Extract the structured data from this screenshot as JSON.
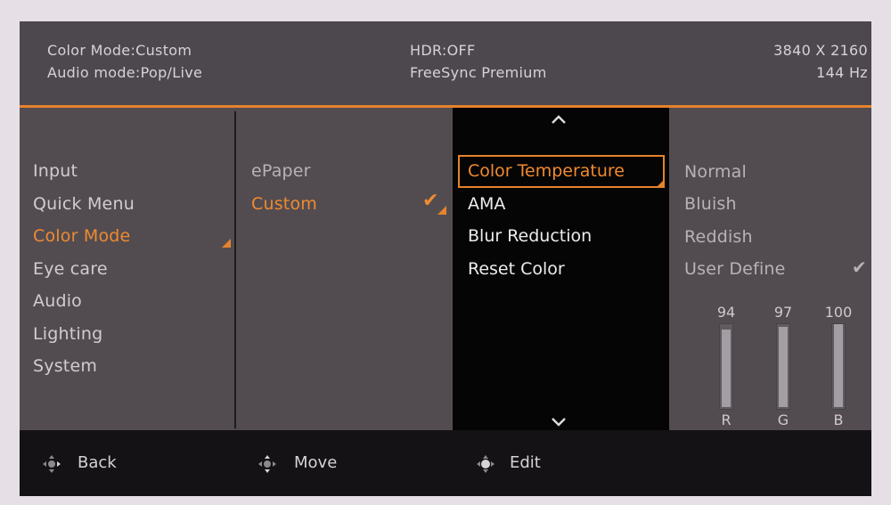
{
  "header": {
    "color_mode": "Color Mode:Custom",
    "audio_mode": "Audio mode:Pop/Live",
    "hdr": "HDR:OFF",
    "freesync": "FreeSync Premium",
    "resolution": "3840 X 2160",
    "refresh": "144 Hz"
  },
  "main_menu": {
    "items": [
      "Input",
      "Quick Menu",
      "Color Mode",
      "Eye care",
      "Audio",
      "Lighting",
      "System"
    ],
    "active": "Color Mode"
  },
  "color_modes": {
    "items": [
      "ePaper",
      "Custom"
    ],
    "active": "Custom"
  },
  "custom_options": {
    "items": [
      "Color Temperature",
      "AMA",
      "Blur Reduction",
      "Reset Color"
    ],
    "active": "Color Temperature"
  },
  "color_temperature": {
    "items": [
      "Normal",
      "Bluish",
      "Reddish",
      "User Define"
    ],
    "checked": "User Define",
    "rgb": [
      {
        "letter": "R",
        "value": 94
      },
      {
        "letter": "G",
        "value": 97
      },
      {
        "letter": "B",
        "value": 100
      }
    ]
  },
  "footer": {
    "back": "Back",
    "move": "Move",
    "edit": "Edit"
  },
  "colors": {
    "accent": "#e5832c",
    "panel": "#524c51",
    "black_panel": "#050505"
  },
  "icons": {
    "scroll_up": "chevron-up-icon",
    "scroll_down": "chevron-down-icon",
    "check": "check-icon",
    "joystick": "joystick-icon"
  }
}
